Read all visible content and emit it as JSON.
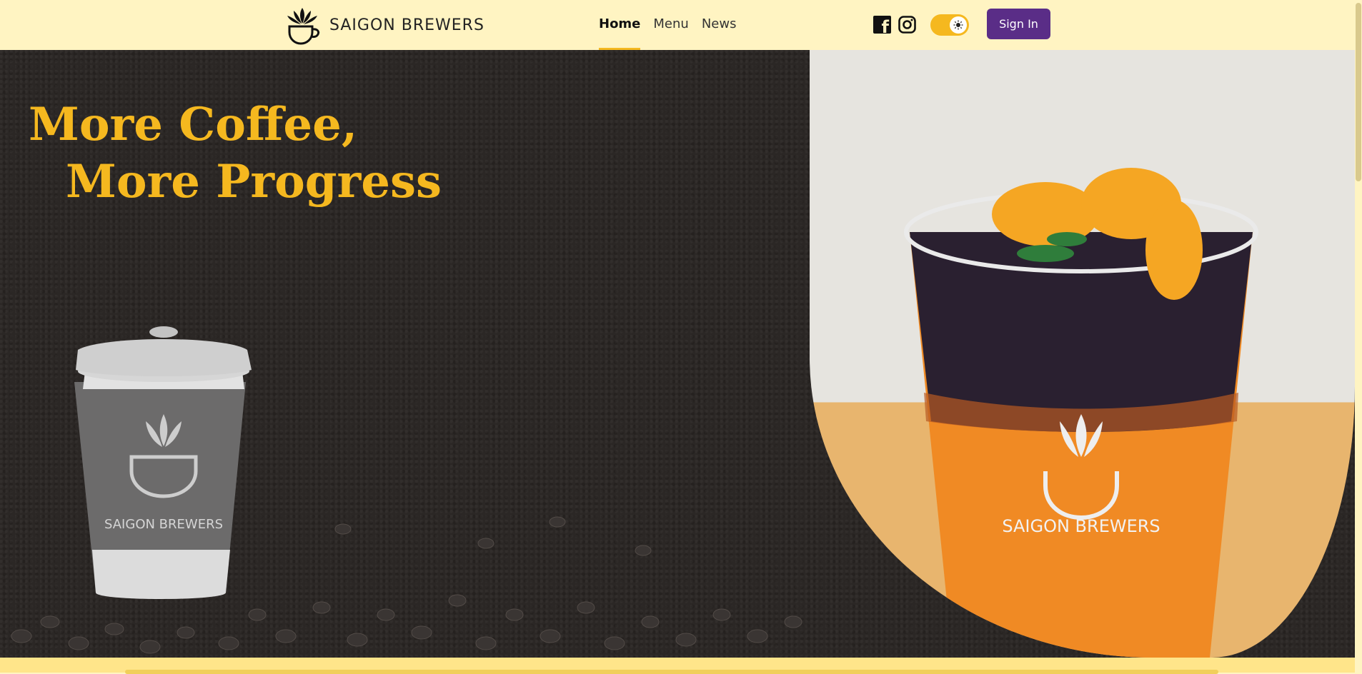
{
  "header": {
    "brand_name": "SAIGON BREWERS",
    "nav": [
      {
        "label": "Home",
        "active": true
      },
      {
        "label": "Menu",
        "active": false
      },
      {
        "label": "News",
        "active": false
      }
    ],
    "social": [
      "facebook-icon",
      "instagram-icon"
    ],
    "theme_toggle": {
      "state": "light",
      "icon": "sun-icon"
    },
    "signin_label": "Sign In"
  },
  "hero": {
    "headline_line1": "More Coffee,",
    "headline_line2": "More Progress",
    "cup_label": "SAIGON BREWERS",
    "photo_label": "SAIGON BREWERS"
  },
  "colors": {
    "header_bg": "#fff4c2",
    "accent": "#f5b81f",
    "button": "#5a2d87",
    "hero_bg": "#2b2725"
  }
}
